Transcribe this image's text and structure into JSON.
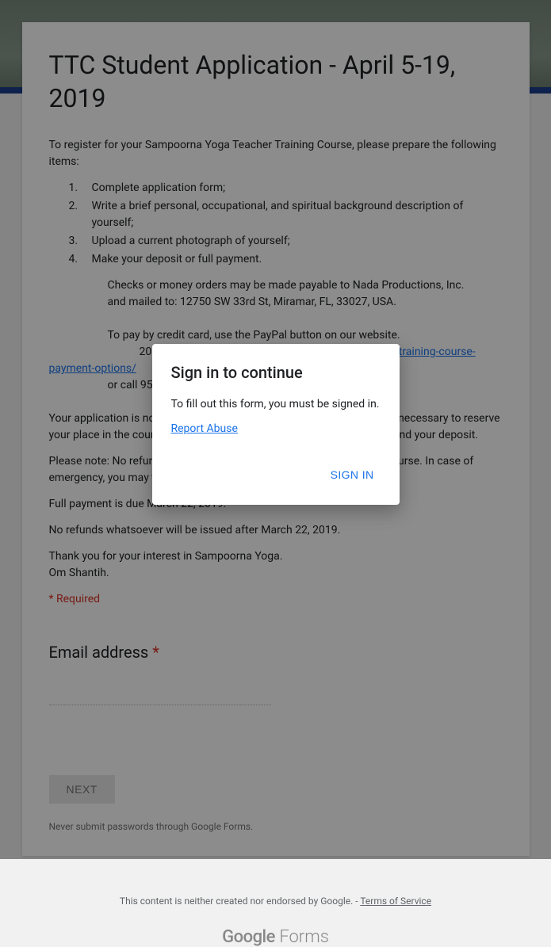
{
  "form": {
    "title": "TTC Student Application - April 5-19, 2019",
    "intro": "To register for your Sampoorna Yoga Teacher Training Course, please prepare the following items:",
    "steps": [
      "Complete application form;",
      "Write a brief personal, occupational, and spiritual background description of yourself;",
      "Upload a current photograph of yourself;",
      "Make your deposit or full payment."
    ],
    "checks_line1": "Checks or money orders may be made payable to Nada Productions, Inc.",
    "checks_line2": "and mailed to: 12750 SW 33rd St, Miramar, FL, 33027, USA.",
    "cc_line": "To pay by credit card, use the PayPal button on our website.",
    "hour_prefix": "200-hour: ",
    "hour_link": "www.yogihari.com/200-hour-yoga-teacher-training-course-payment-options/",
    "call_line": "or call 954-399-8000.",
    "deposit_para": "Your application is not complete until we receive your deposit, which is necessary to reserve your place in the course. If your application is not approved, we will refund your deposit.",
    "note_para": "Please note: No refund of deposit will be made within 30 days of the course. In case of emergency, you may transfer your deposit to a future TTC course.",
    "fullpay_para": "Full payment is due March 22, 2019.",
    "norefund_para": "No refunds whatsoever will be issued after March 22, 2019.",
    "thanks_line": "Thank you for your interest in Sampoorna Yoga.",
    "om_line": "Om Shantih.",
    "required_label": "* Required",
    "email_label": "Email address ",
    "asterisk": "*",
    "next_label": "NEXT",
    "pw_warning": "Never submit passwords through Google Forms."
  },
  "footer": {
    "text": "This content is neither created nor endorsed by Google. - ",
    "tos": "Terms of Service",
    "logo_google": "Google",
    "logo_forms": " Forms"
  },
  "modal": {
    "title": "Sign in to continue",
    "body": "To fill out this form, you must be signed in.",
    "report": "Report Abuse",
    "signin": "SIGN IN"
  }
}
